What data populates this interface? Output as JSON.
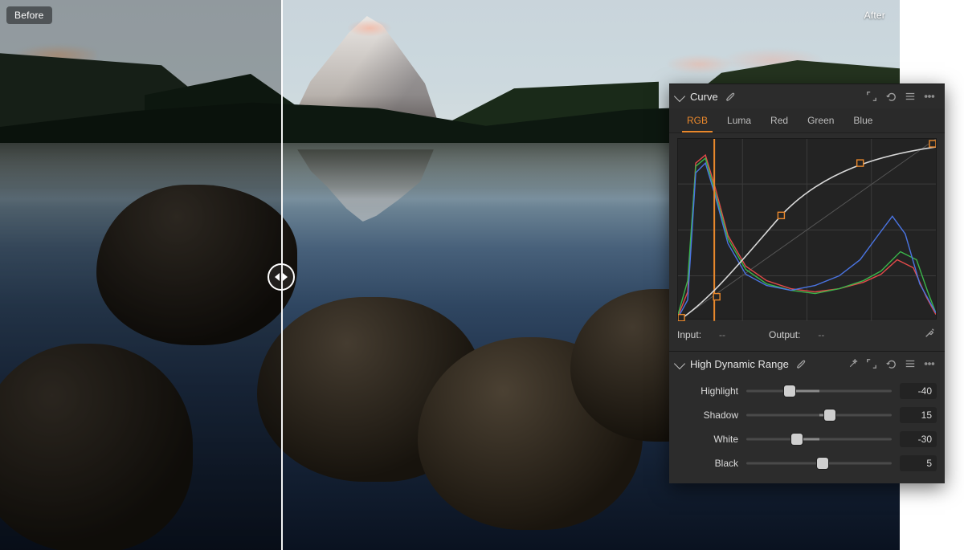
{
  "compare": {
    "before_label": "Before",
    "after_label": "After",
    "split_pct": 31.25
  },
  "curve_panel": {
    "title": "Curve",
    "tabs": [
      "RGB",
      "Luma",
      "Red",
      "Green",
      "Blue"
    ],
    "active_tab": 0,
    "input_label": "Input:",
    "output_label": "Output:",
    "input_value": "--",
    "output_value": "--",
    "curve_points_pct": [
      [
        0,
        100
      ],
      [
        15,
        88
      ],
      [
        40,
        42
      ],
      [
        70,
        18
      ],
      [
        100,
        4
      ]
    ]
  },
  "hdr_panel": {
    "title": "High Dynamic Range",
    "sliders": [
      {
        "label": "Highlight",
        "value": -40,
        "min": -100,
        "max": 100
      },
      {
        "label": "Shadow",
        "value": 15,
        "min": -100,
        "max": 100
      },
      {
        "label": "White",
        "value": -30,
        "min": -100,
        "max": 100
      },
      {
        "label": "Black",
        "value": 5,
        "min": -100,
        "max": 100
      }
    ]
  },
  "colors": {
    "accent": "#e9882c",
    "panel_bg": "#2c2c2c"
  },
  "chart_data": {
    "type": "line",
    "title": "Curve — RGB histogram + tone curve",
    "xlabel": "Input",
    "ylabel": "Output",
    "xlim": [
      0,
      255
    ],
    "ylim": [
      0,
      255
    ],
    "series": [
      {
        "name": "tone-curve",
        "x": [
          0,
          38,
          102,
          179,
          255
        ],
        "y": [
          0,
          30,
          148,
          210,
          245
        ]
      }
    ],
    "histograms": {
      "x": [
        0,
        16,
        32,
        48,
        64,
        80,
        96,
        112,
        128,
        144,
        160,
        176,
        192,
        208,
        224,
        240,
        255
      ],
      "r": [
        3,
        20,
        95,
        60,
        30,
        24,
        20,
        17,
        15,
        14,
        15,
        17,
        18,
        22,
        32,
        20,
        4
      ],
      "g": [
        4,
        28,
        92,
        56,
        28,
        22,
        18,
        16,
        14,
        13,
        14,
        16,
        19,
        24,
        38,
        24,
        5
      ],
      "b": [
        2,
        18,
        88,
        54,
        26,
        20,
        17,
        15,
        14,
        16,
        20,
        30,
        42,
        55,
        46,
        22,
        3
      ]
    },
    "anchor_line_x": 36
  }
}
